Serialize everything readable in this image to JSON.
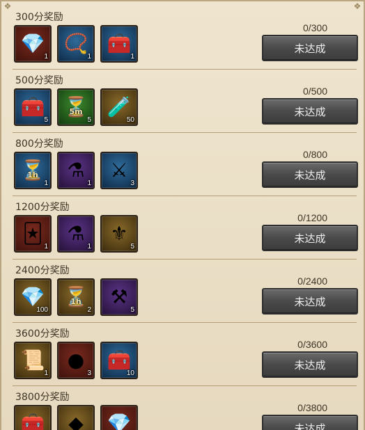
{
  "rows": [
    {
      "title": "300分奖励",
      "progress": "0/300",
      "button": "未达成",
      "items": [
        {
          "icon": "red-gem-icon",
          "glyph": "💎",
          "bg": "bg-red",
          "count": "1"
        },
        {
          "icon": "gold-necklace-icon",
          "glyph": "📿",
          "bg": "bg-blue",
          "count": "1"
        },
        {
          "icon": "mystery-chest-icon",
          "glyph": "🧰",
          "bg": "bg-blue",
          "count": "1"
        }
      ]
    },
    {
      "title": "500分奖励",
      "progress": "0/500",
      "button": "未达成",
      "items": [
        {
          "icon": "treasure-chest-icon",
          "glyph": "🧰",
          "bg": "bg-blue",
          "count": "5"
        },
        {
          "icon": "speedup-5m-icon",
          "glyph": "⏳",
          "bg": "bg-green",
          "count": "5",
          "label": "5m"
        },
        {
          "icon": "green-scroll-icon",
          "glyph": "🧪",
          "bg": "bg-gold",
          "count": "50"
        }
      ]
    },
    {
      "title": "800分奖励",
      "progress": "0/800",
      "button": "未达成",
      "items": [
        {
          "icon": "speedup-1h-icon",
          "glyph": "⏳",
          "bg": "bg-blue",
          "count": "1",
          "label": "1h"
        },
        {
          "icon": "potion-icon",
          "glyph": "⚗",
          "bg": "bg-purple",
          "count": "1"
        },
        {
          "icon": "crossed-swords-icon",
          "glyph": "⚔",
          "bg": "bg-blue",
          "count": "3"
        }
      ]
    },
    {
      "title": "1200分奖励",
      "progress": "0/1200",
      "button": "未达成",
      "items": [
        {
          "icon": "cards-icon",
          "glyph": "🃏",
          "bg": "bg-red",
          "count": "1"
        },
        {
          "icon": "potion-icon",
          "glyph": "⚗",
          "bg": "bg-purple",
          "count": "1"
        },
        {
          "icon": "banner-icon",
          "glyph": "⚜",
          "bg": "bg-gold",
          "count": "5"
        }
      ]
    },
    {
      "title": "2400分奖励",
      "progress": "0/2400",
      "button": "未达成",
      "items": [
        {
          "icon": "blue-diamond-icon",
          "glyph": "💎",
          "bg": "bg-gold",
          "count": "100"
        },
        {
          "icon": "speedup-1h-icon",
          "glyph": "⏳",
          "bg": "bg-gold",
          "count": "2",
          "label": "1h"
        },
        {
          "icon": "hammer-icon",
          "glyph": "⚒",
          "bg": "bg-purple",
          "count": "5"
        }
      ]
    },
    {
      "title": "3600分奖励",
      "progress": "0/3600",
      "button": "未达成",
      "items": [
        {
          "icon": "map-scroll-icon",
          "glyph": "📜",
          "bg": "bg-gold",
          "count": "1"
        },
        {
          "icon": "stone-orb-icon",
          "glyph": "●",
          "bg": "bg-red",
          "count": "3"
        },
        {
          "icon": "treasure-chest-icon",
          "glyph": "🧰",
          "bg": "bg-blue",
          "count": "10"
        }
      ]
    },
    {
      "title": "3800分奖励",
      "progress": "0/3800",
      "button": "未达成",
      "items": [
        {
          "icon": "gold-chest-icon",
          "glyph": "🧰",
          "bg": "bg-gold",
          "count": ""
        },
        {
          "icon": "gold-ore-icon",
          "glyph": "◆",
          "bg": "bg-gold",
          "count": ""
        },
        {
          "icon": "red-gem-icon",
          "glyph": "💎",
          "bg": "bg-red",
          "count": ""
        }
      ]
    }
  ]
}
